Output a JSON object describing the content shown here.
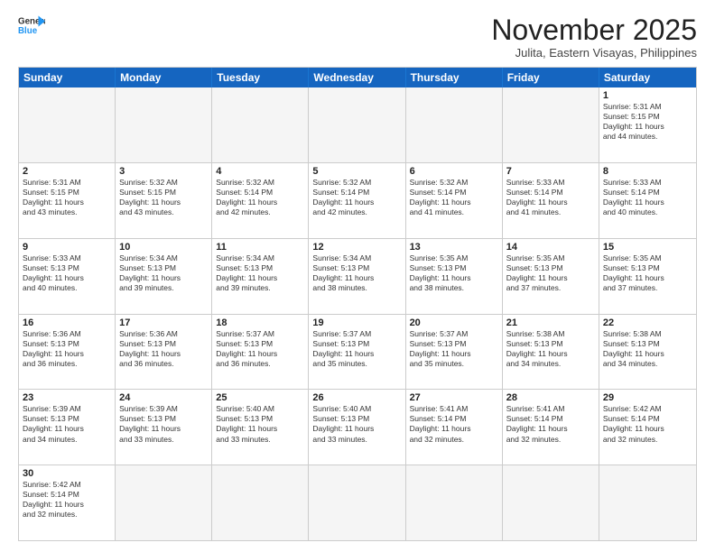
{
  "header": {
    "logo_general": "General",
    "logo_blue": "Blue",
    "month_title": "November 2025",
    "location": "Julita, Eastern Visayas, Philippines"
  },
  "days_of_week": [
    "Sunday",
    "Monday",
    "Tuesday",
    "Wednesday",
    "Thursday",
    "Friday",
    "Saturday"
  ],
  "rows": [
    [
      {
        "day": "",
        "info": ""
      },
      {
        "day": "",
        "info": ""
      },
      {
        "day": "",
        "info": ""
      },
      {
        "day": "",
        "info": ""
      },
      {
        "day": "",
        "info": ""
      },
      {
        "day": "",
        "info": ""
      },
      {
        "day": "1",
        "info": "Sunrise: 5:31 AM\nSunset: 5:15 PM\nDaylight: 11 hours\nand 44 minutes."
      }
    ],
    [
      {
        "day": "2",
        "info": "Sunrise: 5:31 AM\nSunset: 5:15 PM\nDaylight: 11 hours\nand 43 minutes."
      },
      {
        "day": "3",
        "info": "Sunrise: 5:32 AM\nSunset: 5:15 PM\nDaylight: 11 hours\nand 43 minutes."
      },
      {
        "day": "4",
        "info": "Sunrise: 5:32 AM\nSunset: 5:14 PM\nDaylight: 11 hours\nand 42 minutes."
      },
      {
        "day": "5",
        "info": "Sunrise: 5:32 AM\nSunset: 5:14 PM\nDaylight: 11 hours\nand 42 minutes."
      },
      {
        "day": "6",
        "info": "Sunrise: 5:32 AM\nSunset: 5:14 PM\nDaylight: 11 hours\nand 41 minutes."
      },
      {
        "day": "7",
        "info": "Sunrise: 5:33 AM\nSunset: 5:14 PM\nDaylight: 11 hours\nand 41 minutes."
      },
      {
        "day": "8",
        "info": "Sunrise: 5:33 AM\nSunset: 5:14 PM\nDaylight: 11 hours\nand 40 minutes."
      }
    ],
    [
      {
        "day": "9",
        "info": "Sunrise: 5:33 AM\nSunset: 5:13 PM\nDaylight: 11 hours\nand 40 minutes."
      },
      {
        "day": "10",
        "info": "Sunrise: 5:34 AM\nSunset: 5:13 PM\nDaylight: 11 hours\nand 39 minutes."
      },
      {
        "day": "11",
        "info": "Sunrise: 5:34 AM\nSunset: 5:13 PM\nDaylight: 11 hours\nand 39 minutes."
      },
      {
        "day": "12",
        "info": "Sunrise: 5:34 AM\nSunset: 5:13 PM\nDaylight: 11 hours\nand 38 minutes."
      },
      {
        "day": "13",
        "info": "Sunrise: 5:35 AM\nSunset: 5:13 PM\nDaylight: 11 hours\nand 38 minutes."
      },
      {
        "day": "14",
        "info": "Sunrise: 5:35 AM\nSunset: 5:13 PM\nDaylight: 11 hours\nand 37 minutes."
      },
      {
        "day": "15",
        "info": "Sunrise: 5:35 AM\nSunset: 5:13 PM\nDaylight: 11 hours\nand 37 minutes."
      }
    ],
    [
      {
        "day": "16",
        "info": "Sunrise: 5:36 AM\nSunset: 5:13 PM\nDaylight: 11 hours\nand 36 minutes."
      },
      {
        "day": "17",
        "info": "Sunrise: 5:36 AM\nSunset: 5:13 PM\nDaylight: 11 hours\nand 36 minutes."
      },
      {
        "day": "18",
        "info": "Sunrise: 5:37 AM\nSunset: 5:13 PM\nDaylight: 11 hours\nand 36 minutes."
      },
      {
        "day": "19",
        "info": "Sunrise: 5:37 AM\nSunset: 5:13 PM\nDaylight: 11 hours\nand 35 minutes."
      },
      {
        "day": "20",
        "info": "Sunrise: 5:37 AM\nSunset: 5:13 PM\nDaylight: 11 hours\nand 35 minutes."
      },
      {
        "day": "21",
        "info": "Sunrise: 5:38 AM\nSunset: 5:13 PM\nDaylight: 11 hours\nand 34 minutes."
      },
      {
        "day": "22",
        "info": "Sunrise: 5:38 AM\nSunset: 5:13 PM\nDaylight: 11 hours\nand 34 minutes."
      }
    ],
    [
      {
        "day": "23",
        "info": "Sunrise: 5:39 AM\nSunset: 5:13 PM\nDaylight: 11 hours\nand 34 minutes."
      },
      {
        "day": "24",
        "info": "Sunrise: 5:39 AM\nSunset: 5:13 PM\nDaylight: 11 hours\nand 33 minutes."
      },
      {
        "day": "25",
        "info": "Sunrise: 5:40 AM\nSunset: 5:13 PM\nDaylight: 11 hours\nand 33 minutes."
      },
      {
        "day": "26",
        "info": "Sunrise: 5:40 AM\nSunset: 5:13 PM\nDaylight: 11 hours\nand 33 minutes."
      },
      {
        "day": "27",
        "info": "Sunrise: 5:41 AM\nSunset: 5:14 PM\nDaylight: 11 hours\nand 32 minutes."
      },
      {
        "day": "28",
        "info": "Sunrise: 5:41 AM\nSunset: 5:14 PM\nDaylight: 11 hours\nand 32 minutes."
      },
      {
        "day": "29",
        "info": "Sunrise: 5:42 AM\nSunset: 5:14 PM\nDaylight: 11 hours\nand 32 minutes."
      }
    ],
    [
      {
        "day": "30",
        "info": "Sunrise: 5:42 AM\nSunset: 5:14 PM\nDaylight: 11 hours\nand 32 minutes."
      },
      {
        "day": "",
        "info": ""
      },
      {
        "day": "",
        "info": ""
      },
      {
        "day": "",
        "info": ""
      },
      {
        "day": "",
        "info": ""
      },
      {
        "day": "",
        "info": ""
      },
      {
        "day": "",
        "info": ""
      }
    ]
  ]
}
